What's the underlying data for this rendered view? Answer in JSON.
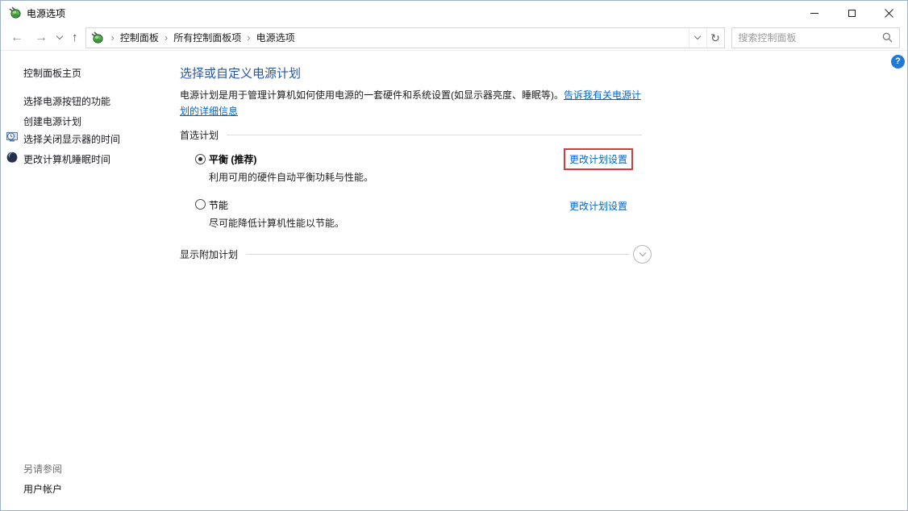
{
  "window": {
    "title": "电源选项"
  },
  "navbar": {
    "breadcrumb": [
      "控制面板",
      "所有控制面板项",
      "电源选项"
    ],
    "search_placeholder": "搜索控制面板"
  },
  "help": {
    "label": "?"
  },
  "sidebar": {
    "home": "控制面板主页",
    "tasks": [
      {
        "label": "选择电源按钮的功能"
      },
      {
        "label": "创建电源计划"
      },
      {
        "label": "选择关闭显示器的时间",
        "icon": "display-clock-icon"
      },
      {
        "label": "更改计算机睡眠时间",
        "icon": "sleep-sphere-icon"
      }
    ],
    "see_also_header": "另请参阅",
    "see_also_items": [
      "用户帐户"
    ]
  },
  "main": {
    "heading": "选择或自定义电源计划",
    "intro_text": "电源计划是用于管理计算机如何使用电源的一套硬件和系统设置(如显示器亮度、睡眠等)。",
    "intro_link": "告诉我有关电源计划的详细信息",
    "preferred_header": "首选计划",
    "plans": [
      {
        "name": "平衡 (推荐)",
        "desc": "利用可用的硬件自动平衡功耗与性能。",
        "link": "更改计划设置",
        "selected": true,
        "highlighted": true
      },
      {
        "name": "节能",
        "desc": "尽可能降低计算机性能以节能。",
        "link": "更改计划设置",
        "selected": false,
        "highlighted": false
      }
    ],
    "additional_header": "显示附加计划"
  },
  "icons": {
    "app": "power-plug-icon",
    "search": "search-icon",
    "refresh": "refresh-icon",
    "help": "help-icon"
  },
  "colors": {
    "heading_blue": "#2855a0",
    "link_blue": "#0066cc",
    "annotation_red": "#d23c3c",
    "help_blue": "#2079d5",
    "plug_green": "#5cb352"
  }
}
